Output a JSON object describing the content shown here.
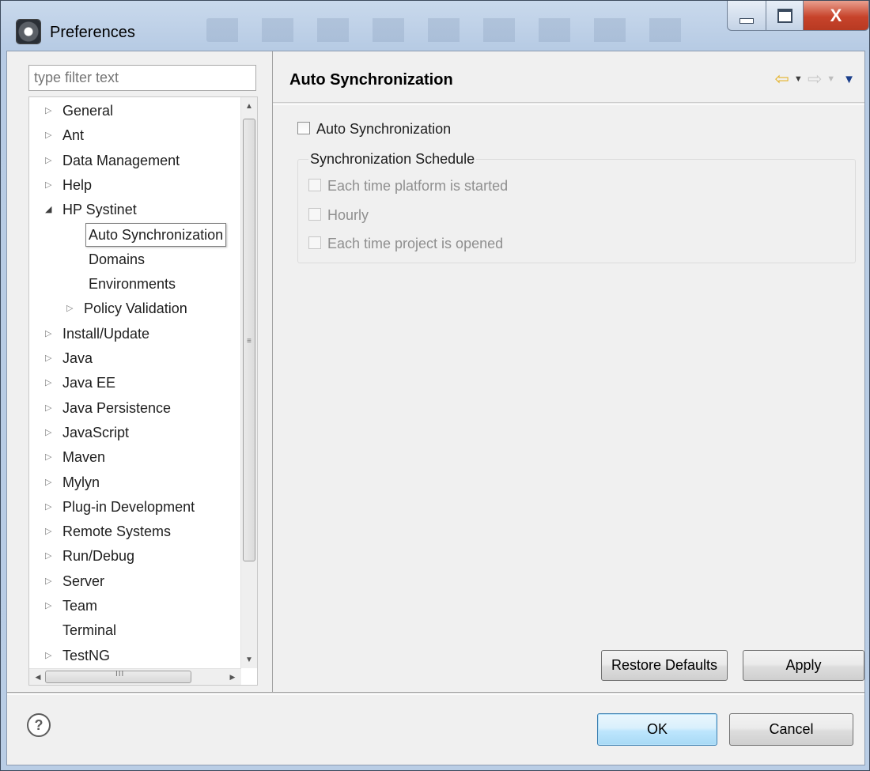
{
  "window": {
    "title": "Preferences"
  },
  "filter": {
    "placeholder": "type filter text"
  },
  "tree": {
    "items": [
      {
        "label": "General",
        "expander": "▷"
      },
      {
        "label": "Ant",
        "expander": "▷"
      },
      {
        "label": "Data Management",
        "expander": "▷"
      },
      {
        "label": "Help",
        "expander": "▷"
      },
      {
        "label": "HP Systinet",
        "expander": "◢"
      },
      {
        "label": "Auto Synchronization",
        "expander": "",
        "selected": true
      },
      {
        "label": "Domains",
        "expander": ""
      },
      {
        "label": "Environments",
        "expander": ""
      },
      {
        "label": "Policy Validation",
        "expander": "▷"
      },
      {
        "label": "Install/Update",
        "expander": "▷"
      },
      {
        "label": "Java",
        "expander": "▷"
      },
      {
        "label": "Java EE",
        "expander": "▷"
      },
      {
        "label": "Java Persistence",
        "expander": "▷"
      },
      {
        "label": "JavaScript",
        "expander": "▷"
      },
      {
        "label": "Maven",
        "expander": "▷"
      },
      {
        "label": "Mylyn",
        "expander": "▷"
      },
      {
        "label": "Plug-in Development",
        "expander": "▷"
      },
      {
        "label": "Remote Systems",
        "expander": "▷"
      },
      {
        "label": "Run/Debug",
        "expander": "▷"
      },
      {
        "label": "Server",
        "expander": "▷"
      },
      {
        "label": "Team",
        "expander": "▷"
      },
      {
        "label": "Terminal",
        "expander": ""
      },
      {
        "label": "TestNG",
        "expander": "▷"
      }
    ],
    "scroll_grip_v": "≡",
    "scroll_grip_h": "III"
  },
  "page": {
    "title": "Auto Synchronization",
    "enable_checkbox": {
      "label": "Auto Synchronization",
      "checked": false
    },
    "schedule_group": {
      "legend": "Synchronization Schedule",
      "options": [
        {
          "label": "Each time platform is started",
          "checked": false,
          "enabled": false
        },
        {
          "label": "Hourly",
          "checked": false,
          "enabled": false
        },
        {
          "label": "Each time project is opened",
          "checked": false,
          "enabled": false
        }
      ]
    },
    "restore_defaults_label": "Restore Defaults",
    "apply_label": "Apply"
  },
  "footer": {
    "help_glyph": "?",
    "ok_label": "OK",
    "cancel_label": "Cancel"
  },
  "window_buttons": {
    "close_glyph": "X"
  },
  "colors": {
    "accent_back_arrow": "#e5b32a",
    "ok_button_border": "#3c7fb1",
    "close_button": "#c7432b"
  }
}
